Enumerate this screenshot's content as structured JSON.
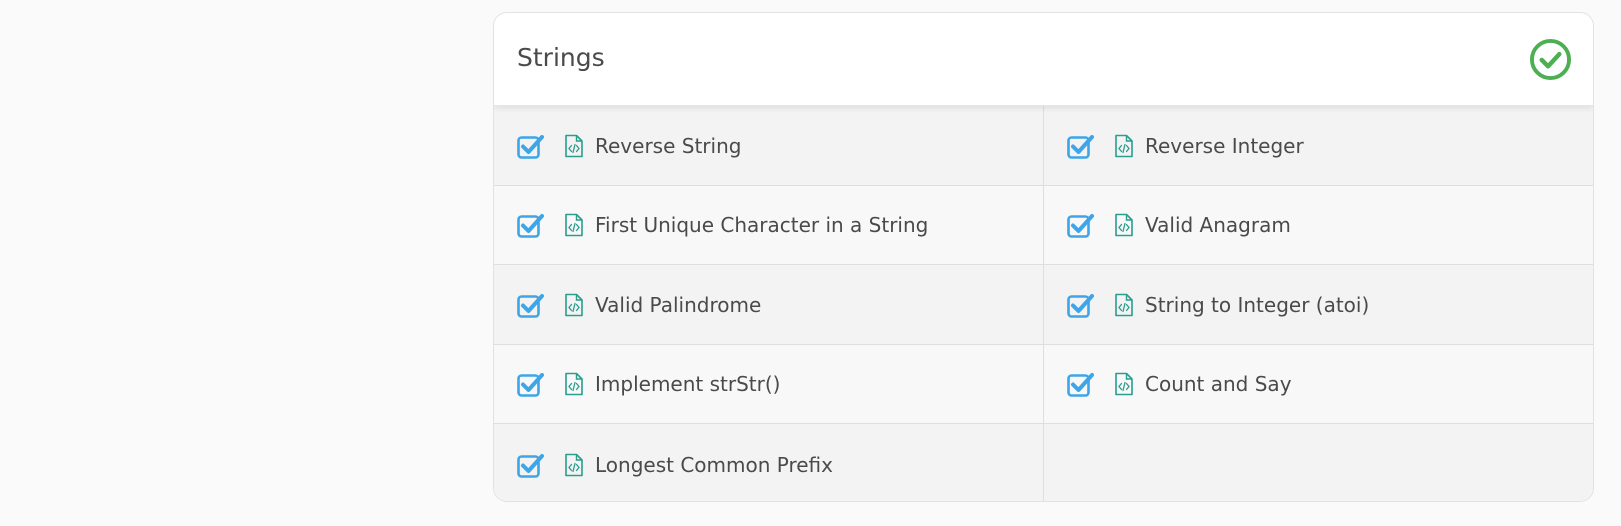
{
  "section": {
    "title": "Strings",
    "status_icon": "check-circle-icon",
    "status_color": "#4caf50"
  },
  "colors": {
    "checkbox": "#3da5e8",
    "file_icon": "#2a9d8f",
    "text": "#4a4a4a"
  },
  "problems": [
    {
      "label": "Reverse String",
      "checked": true,
      "icon": "code-file-icon"
    },
    {
      "label": "Reverse Integer",
      "checked": true,
      "icon": "code-file-icon"
    },
    {
      "label": "First Unique Character in a String",
      "checked": true,
      "icon": "code-file-icon"
    },
    {
      "label": "Valid Anagram",
      "checked": true,
      "icon": "code-file-icon"
    },
    {
      "label": "Valid Palindrome",
      "checked": true,
      "icon": "code-file-icon"
    },
    {
      "label": "String to Integer (atoi)",
      "checked": true,
      "icon": "code-file-icon"
    },
    {
      "label": "Implement strStr()",
      "checked": true,
      "icon": "code-file-icon"
    },
    {
      "label": "Count and Say",
      "checked": true,
      "icon": "code-file-icon"
    },
    {
      "label": "Longest Common Prefix",
      "checked": true,
      "icon": "code-file-icon"
    }
  ]
}
